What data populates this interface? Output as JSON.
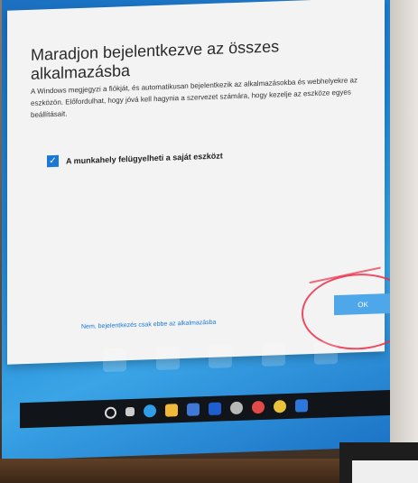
{
  "dialog": {
    "title": "Maradjon bejelentkezve az összes alkalmazásba",
    "description": "A Windows megjegyzi a fiókját, és automatikusan bejelentkezik az alkalmazásokba és webhelyekre az eszközön. Előfordulhat, hogy jóvá kell hagynia a szervezet számára, hogy kezelje az eszköze egyes beállításait.",
    "checkbox_label": "A munkahely felügyelheti a saját eszközt",
    "checkbox_checked": true,
    "link_label": "Nem, bejelentkezés csak ebbe az alkalmazásba",
    "ok_label": "OK"
  },
  "colors": {
    "accent": "#1a78d6",
    "annotation": "#eb2d46",
    "desktop": "#1f87d6"
  },
  "taskbar": {
    "icons": [
      "search-icon",
      "task-view-icon",
      "edge-icon",
      "file-explorer-icon",
      "store-icon",
      "mail-icon",
      "settings-icon",
      "media-icon",
      "chrome-icon",
      "app-icon"
    ]
  }
}
